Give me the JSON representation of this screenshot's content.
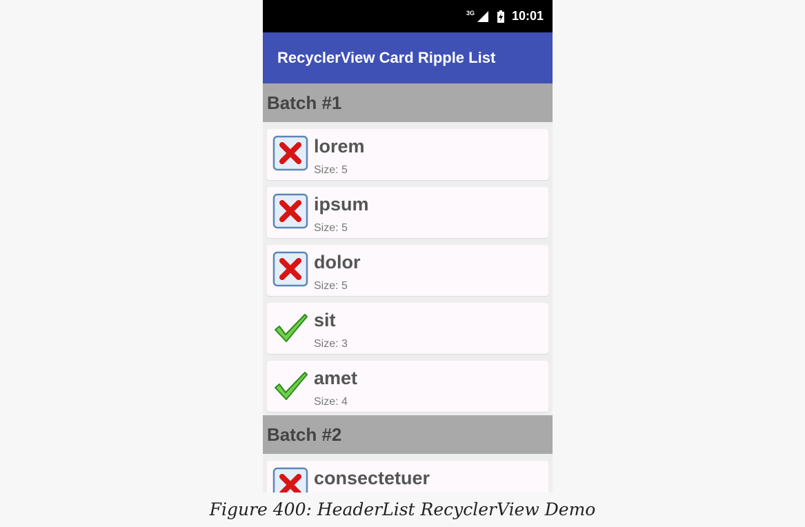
{
  "status_bar": {
    "network": "3G",
    "time": "10:01"
  },
  "toolbar": {
    "title": "RecyclerView Card Ripple List"
  },
  "sections": [
    {
      "header": "Batch #1",
      "items": [
        {
          "word": "lorem",
          "size_label": "Size: 5",
          "icon": "delete-icon"
        },
        {
          "word": "ipsum",
          "size_label": "Size: 5",
          "icon": "delete-icon"
        },
        {
          "word": "dolor",
          "size_label": "Size: 5",
          "icon": "delete-icon"
        },
        {
          "word": "sit",
          "size_label": "Size: 3",
          "icon": "ok-icon"
        },
        {
          "word": "amet",
          "size_label": "Size: 4",
          "icon": "ok-icon"
        }
      ]
    },
    {
      "header": "Batch #2",
      "items": [
        {
          "word": "consectetuer",
          "size_label": "",
          "icon": "delete-icon"
        }
      ]
    }
  ],
  "caption": "Figure 400: HeaderList RecyclerView Demo"
}
